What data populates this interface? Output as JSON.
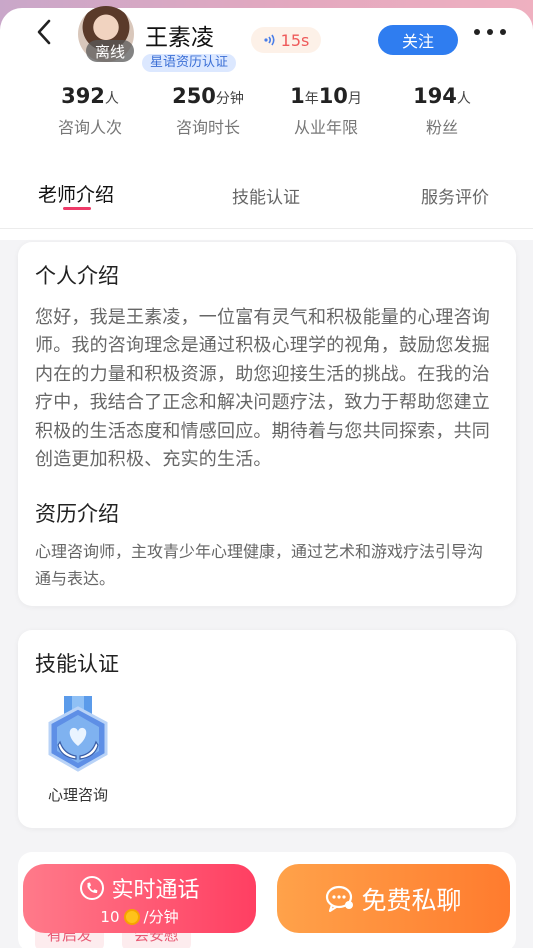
{
  "header": {
    "name": "王素凌",
    "status_badge": "离线",
    "cert_tag": "星语资历认证",
    "voice_duration": "15s",
    "follow_label": "关注"
  },
  "stats": [
    {
      "value": "392",
      "unit": "人",
      "label": "咨询人次"
    },
    {
      "value": "250",
      "unit": "分钟",
      "label": "咨询时长"
    },
    {
      "value1": "1",
      "unit1": "年",
      "value2": "10",
      "unit2": "月",
      "label": "从业年限"
    },
    {
      "value": "194",
      "unit": "人",
      "label": "粉丝"
    }
  ],
  "tabs": [
    {
      "label": "老师介绍",
      "active": true
    },
    {
      "label": "技能认证",
      "active": false
    },
    {
      "label": "服务评价",
      "active": false
    }
  ],
  "intro": {
    "title": "个人介绍",
    "text": "您好，我是王素凌，一位富有灵气和积极能量的心理咨询师。我的咨询理念是通过积极心理学的视角，鼓励您发掘内在的力量和积极资源，助您迎接生活的挑战。在我的治疗中，我结合了正念和解决问题疗法，致力于帮助您建立积极的生活态度和情感回应。期待着与您共同探索，共同创造更加积极、充实的生活。",
    "resume_title": "资历介绍",
    "resume_text": "心理咨询师，主攻青少年心理健康，通过艺术和游戏疗法引导沟通与表达。"
  },
  "skills": {
    "title": "技能认证",
    "items": [
      {
        "label": "心理咨询",
        "icon": "heart-hands-medal-icon"
      }
    ]
  },
  "tags": [
    "有启发",
    "会安慰"
  ],
  "actions": {
    "call_label": "实时通话",
    "call_price": "10",
    "call_unit": "/分钟",
    "chat_label": "免费私聊"
  },
  "colors": {
    "accent_blue": "#2f7df0",
    "tab_underline": "#ee3a68",
    "call_gradient": [
      "#ff7a8a",
      "#ff3f62"
    ],
    "chat_gradient": [
      "#ffa24a",
      "#ff7b2e"
    ]
  }
}
